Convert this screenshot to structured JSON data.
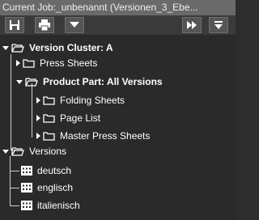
{
  "window": {
    "title": "Current Job:_unbenannt (Versionen_3_Ebe..."
  },
  "toolbar": {
    "buttons": [
      {
        "icon": "save-icon"
      },
      {
        "icon": "print-icon"
      },
      {
        "icon": "dropdown-icon"
      },
      {
        "icon": "fast-forward-icon"
      },
      {
        "icon": "menu-down-icon"
      }
    ]
  },
  "tree": {
    "version_cluster": "Version Cluster: A",
    "press_sheets": "Press Sheets",
    "product_part": "Product Part: All Versions",
    "folding_sheets": "Folding Sheets",
    "page_list": "Page List",
    "master_press_sheets": "Master Press Sheets",
    "versions": "Versions",
    "version_items": [
      "deutsch",
      "englisch",
      "italienisch"
    ]
  }
}
